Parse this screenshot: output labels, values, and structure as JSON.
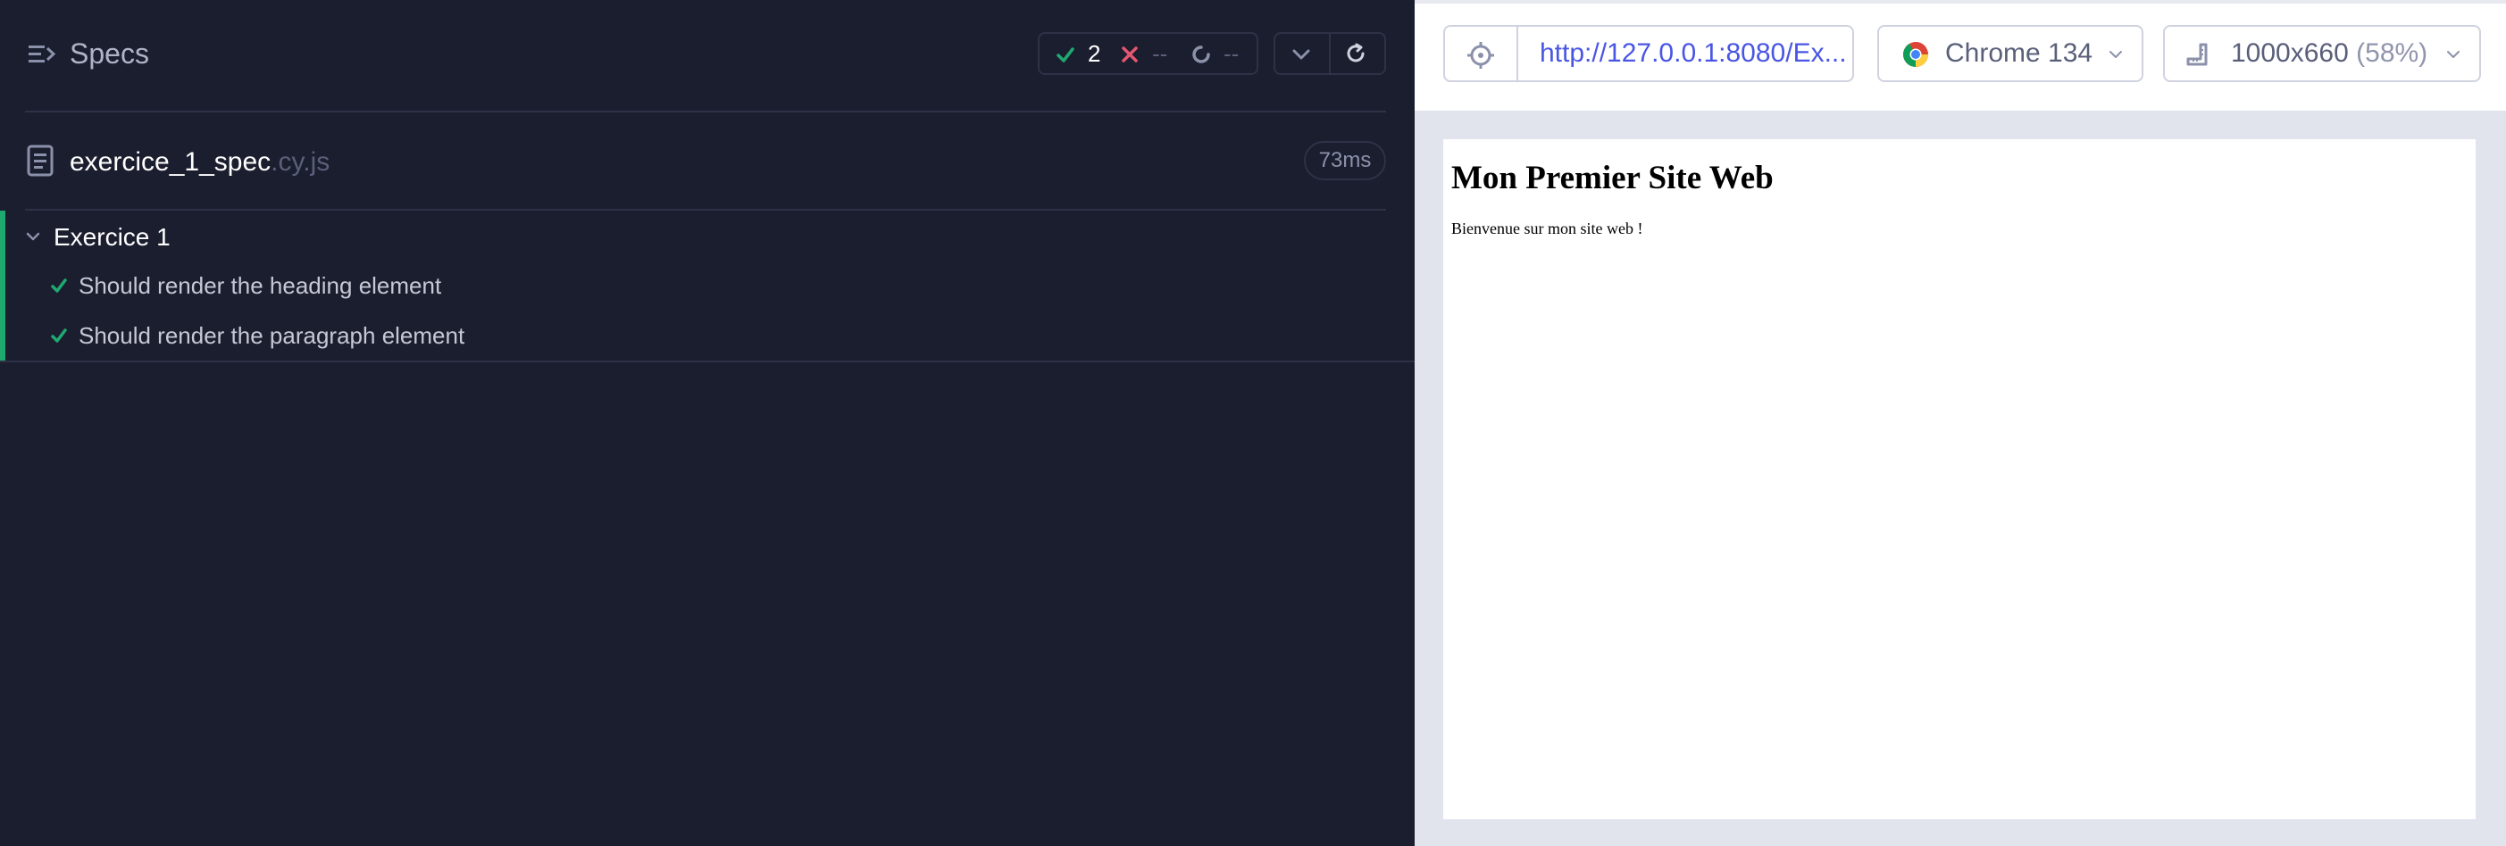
{
  "reporter": {
    "title": "Specs",
    "stats": {
      "passed": "2",
      "failed": "--",
      "pending": "--"
    },
    "spec": {
      "name": "exercice_1_spec",
      "extension": ".cy.js",
      "duration": "73ms"
    },
    "suite": {
      "title": "Exercice 1",
      "tests": [
        {
          "title": "Should render the heading element",
          "state": "passed"
        },
        {
          "title": "Should render the paragraph element",
          "state": "passed"
        }
      ]
    }
  },
  "aut": {
    "url": "http://127.0.0.1:8080/Ex...",
    "browser": "Chrome 134",
    "viewport": {
      "size": "1000x660",
      "scale": "(58%)"
    },
    "page": {
      "heading": "Mon Premier Site Web",
      "paragraph": "Bienvenue sur mon site web !"
    }
  },
  "colors": {
    "reporter_bg": "#1b1e2e",
    "pass_green": "#1fa971",
    "fail_red": "#e45770",
    "url_blue": "#4956e3",
    "aut_bg": "#e1e3ed"
  },
  "icons": [
    "specs-list-icon",
    "check-icon",
    "x-icon",
    "spinner-icon",
    "chevron-down-icon",
    "refresh-icon",
    "file-icon",
    "selector-playground-icon",
    "chrome-logo-icon",
    "viewport-ruler-icon"
  ]
}
